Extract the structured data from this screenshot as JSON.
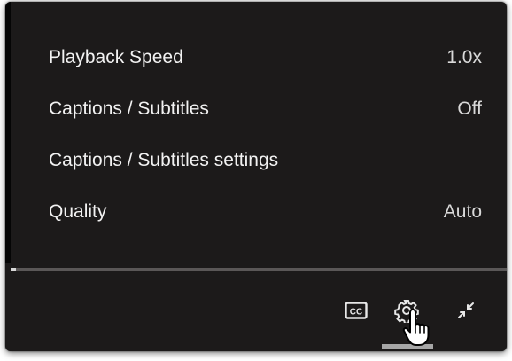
{
  "settings_menu": {
    "items": [
      {
        "label": "Playback Speed",
        "value": "1.0x"
      },
      {
        "label": "Captions / Subtitles",
        "value": "Off"
      },
      {
        "label": "Captions / Subtitles settings",
        "value": ""
      },
      {
        "label": "Quality",
        "value": "Auto"
      }
    ]
  },
  "progress": {
    "played_fraction": 0.01
  },
  "controls": {
    "captions_label": "CC",
    "captions_icon": "cc-icon",
    "settings_icon": "gear-icon",
    "exit_fullscreen_icon": "exit-fullscreen-icon",
    "settings_active": true
  },
  "colors": {
    "panel_background": "#1c1a1a",
    "text": "#f2f2f2",
    "active_indicator": "#a6a6a6"
  }
}
